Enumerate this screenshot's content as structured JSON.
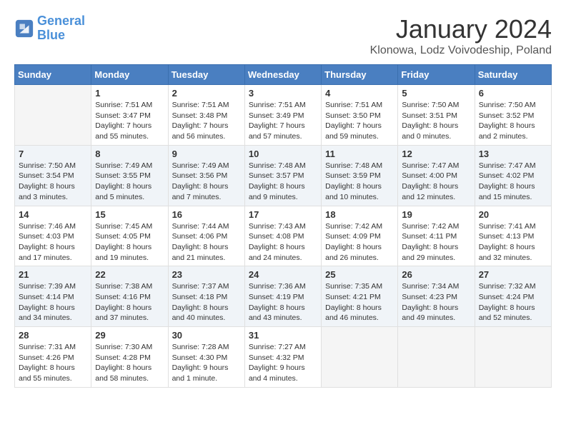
{
  "header": {
    "logo_line1": "General",
    "logo_line2": "Blue",
    "title": "January 2024",
    "subtitle": "Klonowa, Lodz Voivodeship, Poland"
  },
  "days_of_week": [
    "Sunday",
    "Monday",
    "Tuesday",
    "Wednesday",
    "Thursday",
    "Friday",
    "Saturday"
  ],
  "weeks": [
    [
      {
        "day": "",
        "sunrise": "",
        "sunset": "",
        "daylight": ""
      },
      {
        "day": "1",
        "sunrise": "Sunrise: 7:51 AM",
        "sunset": "Sunset: 3:47 PM",
        "daylight": "Daylight: 7 hours and 55 minutes."
      },
      {
        "day": "2",
        "sunrise": "Sunrise: 7:51 AM",
        "sunset": "Sunset: 3:48 PM",
        "daylight": "Daylight: 7 hours and 56 minutes."
      },
      {
        "day": "3",
        "sunrise": "Sunrise: 7:51 AM",
        "sunset": "Sunset: 3:49 PM",
        "daylight": "Daylight: 7 hours and 57 minutes."
      },
      {
        "day": "4",
        "sunrise": "Sunrise: 7:51 AM",
        "sunset": "Sunset: 3:50 PM",
        "daylight": "Daylight: 7 hours and 59 minutes."
      },
      {
        "day": "5",
        "sunrise": "Sunrise: 7:50 AM",
        "sunset": "Sunset: 3:51 PM",
        "daylight": "Daylight: 8 hours and 0 minutes."
      },
      {
        "day": "6",
        "sunrise": "Sunrise: 7:50 AM",
        "sunset": "Sunset: 3:52 PM",
        "daylight": "Daylight: 8 hours and 2 minutes."
      }
    ],
    [
      {
        "day": "7",
        "sunrise": "Sunrise: 7:50 AM",
        "sunset": "Sunset: 3:54 PM",
        "daylight": "Daylight: 8 hours and 3 minutes."
      },
      {
        "day": "8",
        "sunrise": "Sunrise: 7:49 AM",
        "sunset": "Sunset: 3:55 PM",
        "daylight": "Daylight: 8 hours and 5 minutes."
      },
      {
        "day": "9",
        "sunrise": "Sunrise: 7:49 AM",
        "sunset": "Sunset: 3:56 PM",
        "daylight": "Daylight: 8 hours and 7 minutes."
      },
      {
        "day": "10",
        "sunrise": "Sunrise: 7:48 AM",
        "sunset": "Sunset: 3:57 PM",
        "daylight": "Daylight: 8 hours and 9 minutes."
      },
      {
        "day": "11",
        "sunrise": "Sunrise: 7:48 AM",
        "sunset": "Sunset: 3:59 PM",
        "daylight": "Daylight: 8 hours and 10 minutes."
      },
      {
        "day": "12",
        "sunrise": "Sunrise: 7:47 AM",
        "sunset": "Sunset: 4:00 PM",
        "daylight": "Daylight: 8 hours and 12 minutes."
      },
      {
        "day": "13",
        "sunrise": "Sunrise: 7:47 AM",
        "sunset": "Sunset: 4:02 PM",
        "daylight": "Daylight: 8 hours and 15 minutes."
      }
    ],
    [
      {
        "day": "14",
        "sunrise": "Sunrise: 7:46 AM",
        "sunset": "Sunset: 4:03 PM",
        "daylight": "Daylight: 8 hours and 17 minutes."
      },
      {
        "day": "15",
        "sunrise": "Sunrise: 7:45 AM",
        "sunset": "Sunset: 4:05 PM",
        "daylight": "Daylight: 8 hours and 19 minutes."
      },
      {
        "day": "16",
        "sunrise": "Sunrise: 7:44 AM",
        "sunset": "Sunset: 4:06 PM",
        "daylight": "Daylight: 8 hours and 21 minutes."
      },
      {
        "day": "17",
        "sunrise": "Sunrise: 7:43 AM",
        "sunset": "Sunset: 4:08 PM",
        "daylight": "Daylight: 8 hours and 24 minutes."
      },
      {
        "day": "18",
        "sunrise": "Sunrise: 7:42 AM",
        "sunset": "Sunset: 4:09 PM",
        "daylight": "Daylight: 8 hours and 26 minutes."
      },
      {
        "day": "19",
        "sunrise": "Sunrise: 7:42 AM",
        "sunset": "Sunset: 4:11 PM",
        "daylight": "Daylight: 8 hours and 29 minutes."
      },
      {
        "day": "20",
        "sunrise": "Sunrise: 7:41 AM",
        "sunset": "Sunset: 4:13 PM",
        "daylight": "Daylight: 8 hours and 32 minutes."
      }
    ],
    [
      {
        "day": "21",
        "sunrise": "Sunrise: 7:39 AM",
        "sunset": "Sunset: 4:14 PM",
        "daylight": "Daylight: 8 hours and 34 minutes."
      },
      {
        "day": "22",
        "sunrise": "Sunrise: 7:38 AM",
        "sunset": "Sunset: 4:16 PM",
        "daylight": "Daylight: 8 hours and 37 minutes."
      },
      {
        "day": "23",
        "sunrise": "Sunrise: 7:37 AM",
        "sunset": "Sunset: 4:18 PM",
        "daylight": "Daylight: 8 hours and 40 minutes."
      },
      {
        "day": "24",
        "sunrise": "Sunrise: 7:36 AM",
        "sunset": "Sunset: 4:19 PM",
        "daylight": "Daylight: 8 hours and 43 minutes."
      },
      {
        "day": "25",
        "sunrise": "Sunrise: 7:35 AM",
        "sunset": "Sunset: 4:21 PM",
        "daylight": "Daylight: 8 hours and 46 minutes."
      },
      {
        "day": "26",
        "sunrise": "Sunrise: 7:34 AM",
        "sunset": "Sunset: 4:23 PM",
        "daylight": "Daylight: 8 hours and 49 minutes."
      },
      {
        "day": "27",
        "sunrise": "Sunrise: 7:32 AM",
        "sunset": "Sunset: 4:24 PM",
        "daylight": "Daylight: 8 hours and 52 minutes."
      }
    ],
    [
      {
        "day": "28",
        "sunrise": "Sunrise: 7:31 AM",
        "sunset": "Sunset: 4:26 PM",
        "daylight": "Daylight: 8 hours and 55 minutes."
      },
      {
        "day": "29",
        "sunrise": "Sunrise: 7:30 AM",
        "sunset": "Sunset: 4:28 PM",
        "daylight": "Daylight: 8 hours and 58 minutes."
      },
      {
        "day": "30",
        "sunrise": "Sunrise: 7:28 AM",
        "sunset": "Sunset: 4:30 PM",
        "daylight": "Daylight: 9 hours and 1 minute."
      },
      {
        "day": "31",
        "sunrise": "Sunrise: 7:27 AM",
        "sunset": "Sunset: 4:32 PM",
        "daylight": "Daylight: 9 hours and 4 minutes."
      },
      {
        "day": "",
        "sunrise": "",
        "sunset": "",
        "daylight": ""
      },
      {
        "day": "",
        "sunrise": "",
        "sunset": "",
        "daylight": ""
      },
      {
        "day": "",
        "sunrise": "",
        "sunset": "",
        "daylight": ""
      }
    ]
  ]
}
